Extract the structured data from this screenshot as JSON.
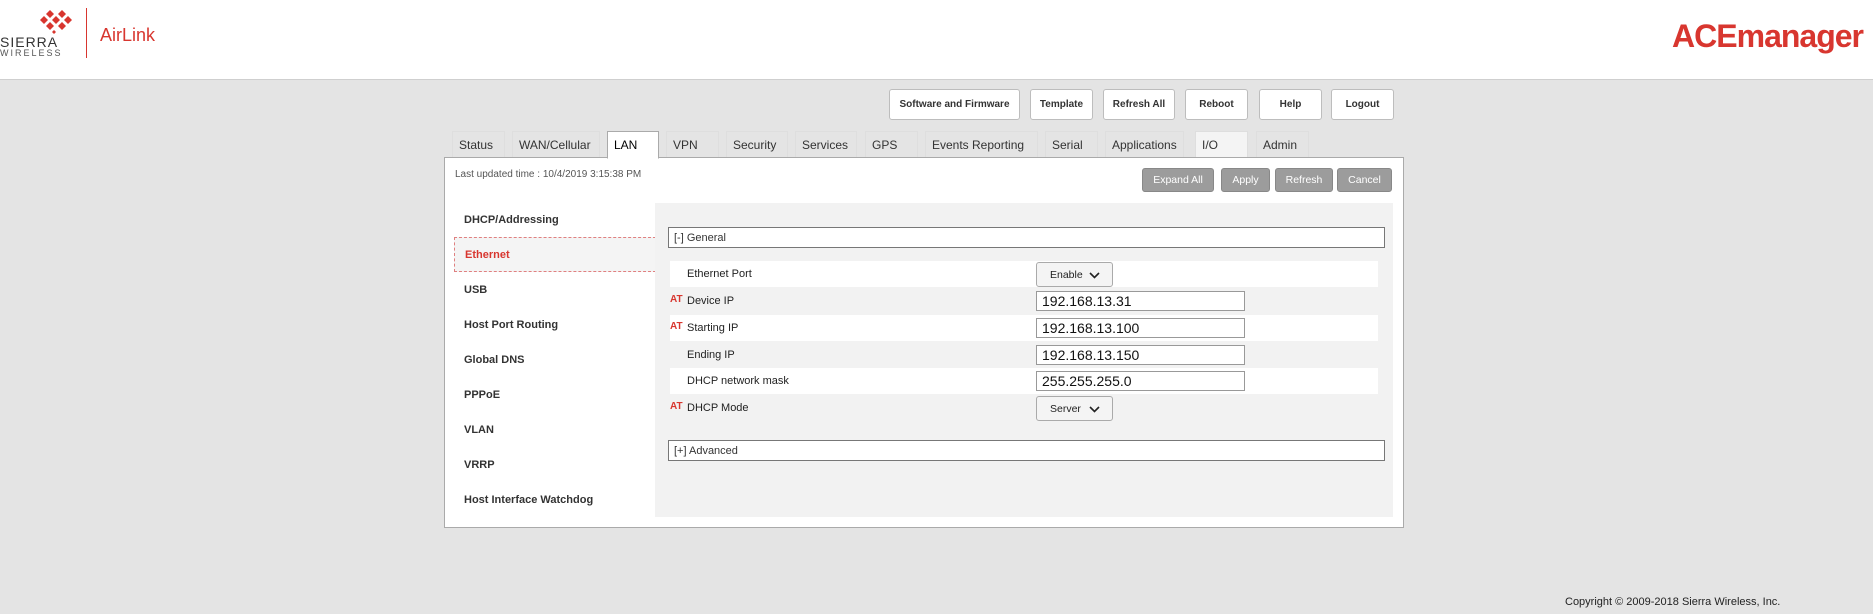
{
  "header": {
    "logo_word1": "SIERRA",
    "logo_word2": "WIRELESS",
    "logo_airlink": "AirLink",
    "brand": "ACEmanager"
  },
  "toolbar": {
    "buttons": [
      "Software and Firmware",
      "Template",
      "Refresh All",
      "Reboot",
      "Help",
      "Logout"
    ]
  },
  "tabs": [
    "Status",
    "WAN/Cellular",
    "LAN",
    "VPN",
    "Security",
    "Services",
    "GPS",
    "Events Reporting",
    "Serial",
    "Applications",
    "I/O",
    "Admin"
  ],
  "active_tab": "LAN",
  "panel": {
    "last_updated": "Last updated time : 10/4/2019 3:15:38 PM",
    "actions": [
      "Expand All",
      "Apply",
      "Refresh",
      "Cancel"
    ]
  },
  "sidebar": {
    "items": [
      "DHCP/Addressing",
      "Ethernet",
      "USB",
      "Host Port Routing",
      "Global DNS",
      "PPPoE",
      "VLAN",
      "VRRP",
      "Host Interface Watchdog"
    ],
    "active": "Ethernet"
  },
  "sections": {
    "general": "[-] General",
    "advanced": "[+] Advanced"
  },
  "at_marker": "AT",
  "fields": [
    {
      "label": "Ethernet Port",
      "type": "select",
      "value": "Enable",
      "at": false
    },
    {
      "label": "Device IP",
      "type": "input",
      "value": "192.168.13.31",
      "at": true
    },
    {
      "label": "Starting IP",
      "type": "input",
      "value": "192.168.13.100",
      "at": true
    },
    {
      "label": "Ending IP",
      "type": "input",
      "value": "192.168.13.150",
      "at": false
    },
    {
      "label": "DHCP network mask",
      "type": "input",
      "value": "255.255.255.0",
      "at": false
    },
    {
      "label": "DHCP Mode",
      "type": "select",
      "value": "Server",
      "at": true
    }
  ],
  "footer": {
    "copyright": "Copyright © 2009-2018 Sierra Wireless, Inc."
  },
  "colors": {
    "brand_red": "#d8362f",
    "page_bg": "#e4e4e4",
    "action_button": "#9c9c9c"
  }
}
